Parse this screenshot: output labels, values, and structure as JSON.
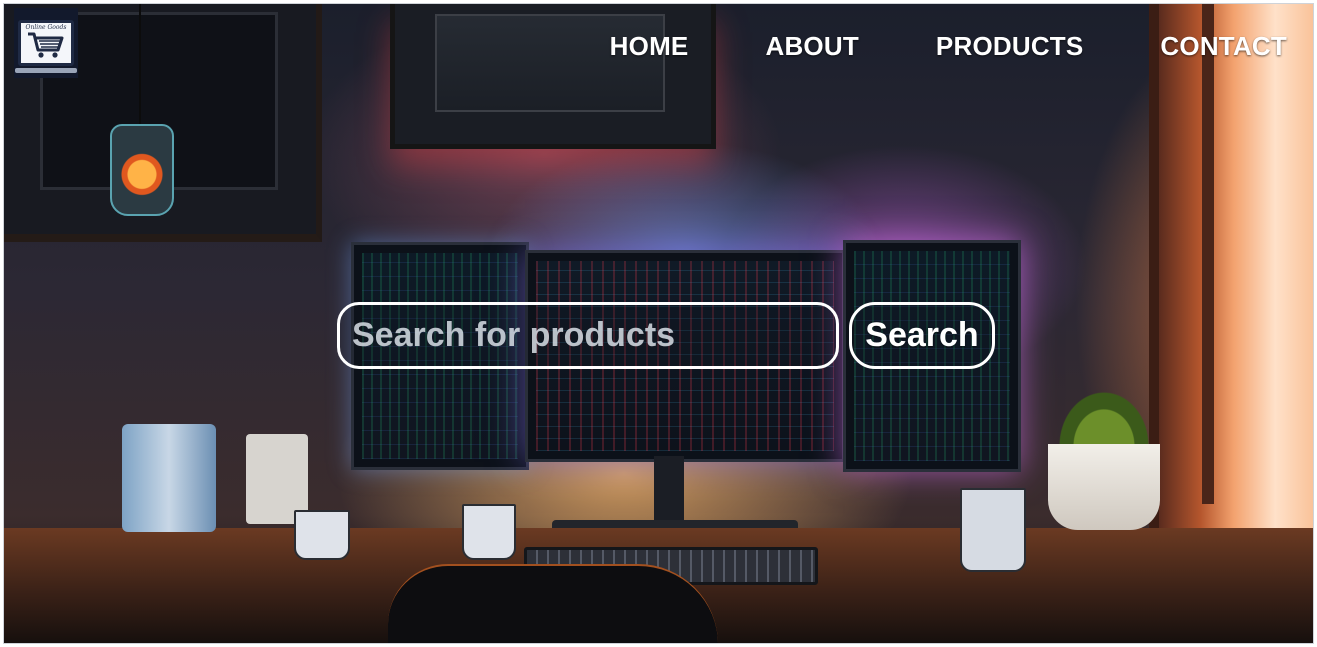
{
  "logo": {
    "icon": "shopping-cart-laptop-icon",
    "tagline": "Online Goods"
  },
  "nav": {
    "items": [
      {
        "label": "HOME"
      },
      {
        "label": "ABOUT"
      },
      {
        "label": "PRODUCTS"
      },
      {
        "label": "CONTACT"
      }
    ]
  },
  "search": {
    "placeholder": "Search for products",
    "value": "",
    "button_label": "Search"
  },
  "colors": {
    "nav_text": "#ffffff",
    "search_border": "#ffffff",
    "logo_background": "#12192c"
  }
}
